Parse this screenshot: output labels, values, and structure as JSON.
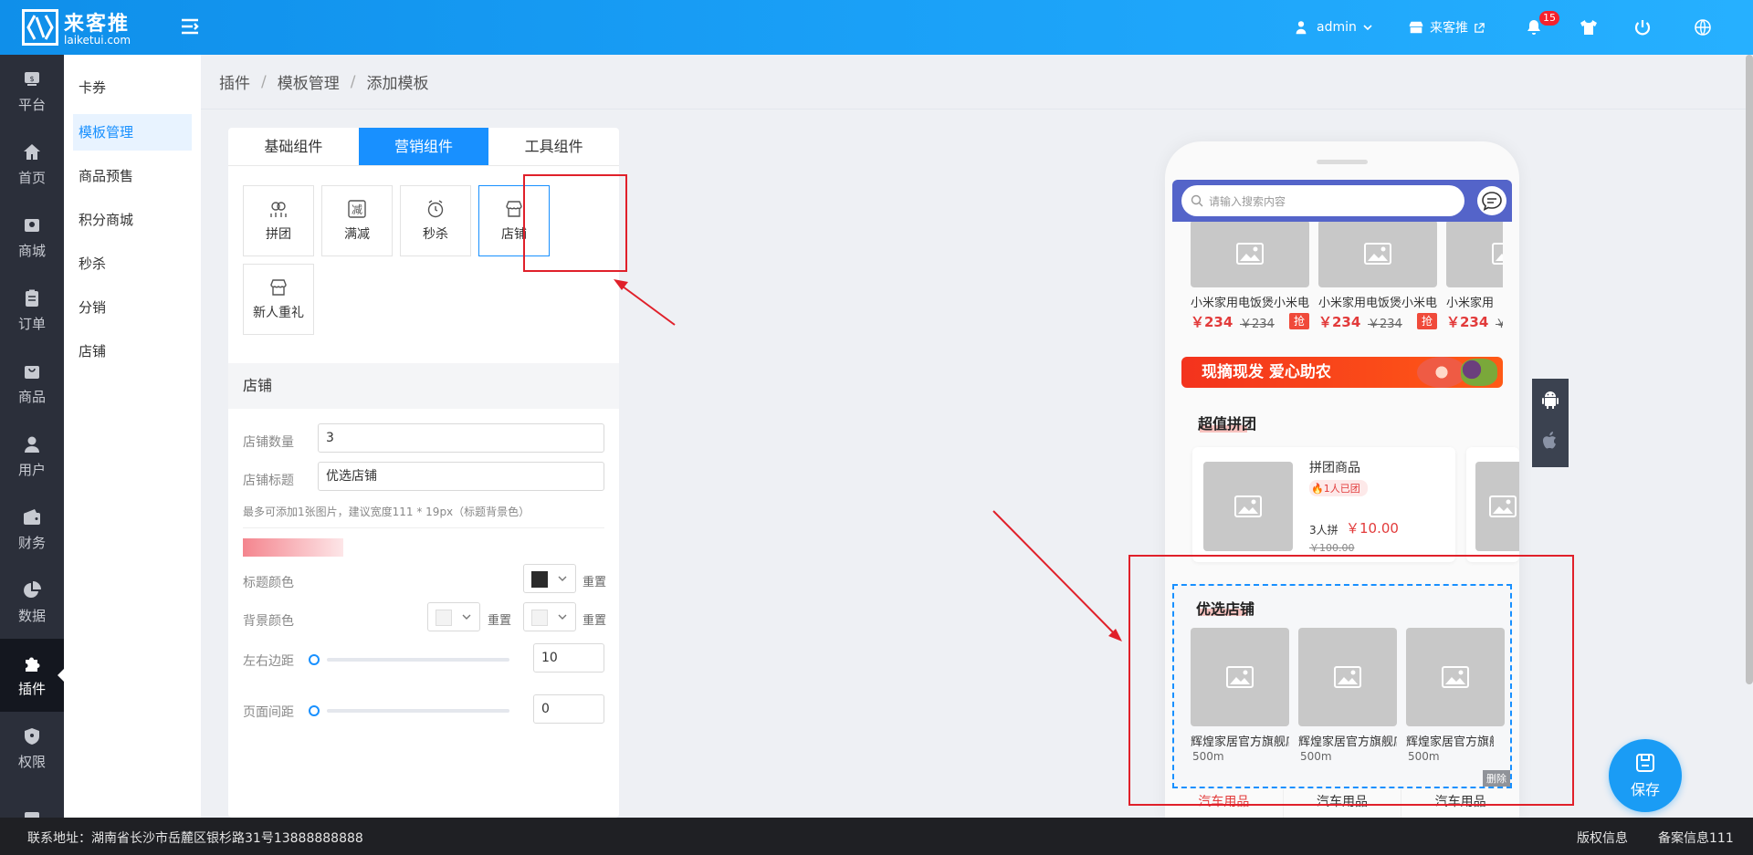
{
  "header": {
    "logo_cn": "来客推",
    "logo_en": "laiketui.com",
    "admin_label": "admin",
    "store_label": "来客推",
    "notification_count": "15"
  },
  "sidebar_main": {
    "items": [
      {
        "label": "平台",
        "icon": "store-sign-icon"
      },
      {
        "label": "首页",
        "icon": "home-icon"
      },
      {
        "label": "商城",
        "icon": "shop-icon"
      },
      {
        "label": "订单",
        "icon": "clipboard-icon"
      },
      {
        "label": "商品",
        "icon": "bag-icon"
      },
      {
        "label": "用户",
        "icon": "user-icon"
      },
      {
        "label": "财务",
        "icon": "wallet-icon"
      },
      {
        "label": "数据",
        "icon": "pie-chart-icon"
      },
      {
        "label": "插件",
        "icon": "puzzle-icon",
        "active": true
      },
      {
        "label": "权限",
        "icon": "shield-icon"
      }
    ]
  },
  "sidebar_sub": {
    "items": [
      "卡券",
      "模板管理",
      "商品预售",
      "积分商城",
      "秒杀",
      "分销",
      "店铺"
    ],
    "active_index": 1
  },
  "breadcrumb": [
    "插件",
    "模板管理",
    "添加模板"
  ],
  "editor": {
    "tabs": [
      "基础组件",
      "营销组件",
      "工具组件"
    ],
    "active_tab": 1,
    "components": [
      {
        "label": "拼团",
        "icon": "group-icon"
      },
      {
        "label": "满减",
        "icon": "discount-icon"
      },
      {
        "label": "秒杀",
        "icon": "alarm-icon"
      },
      {
        "label": "店铺",
        "icon": "store-icon"
      },
      {
        "label": "新人重礼",
        "icon": "gift-icon"
      }
    ],
    "section_title": "店铺",
    "store_count_label": "店铺数量",
    "store_count_value": "3",
    "store_title_label": "店铺标题",
    "store_title_value": "优选店铺",
    "hint": "最多可添加1张图片，建议宽度111 * 19px（标题背景色）",
    "title_color_label": "标题颜色",
    "title_color": "#333333",
    "bg_color_label": "背景颜色",
    "reset_label": "重置",
    "padding_label": "左右边距",
    "padding_value": "10",
    "page_gap_label": "页面间距",
    "page_gap_value": "0",
    "padding_slider_fraction": 0,
    "page_gap_slider_fraction": 0
  },
  "preview": {
    "search_placeholder": "请输入搜索内容",
    "products": [
      {
        "name": "小米家用电饭煲小米电饭煲",
        "price": "￥234",
        "old": "￥234",
        "tag": "抢"
      },
      {
        "name": "小米家用电饭煲小米电饭煲",
        "price": "￥234",
        "old": "￥234",
        "tag": "抢"
      },
      {
        "name": "小米家用",
        "price": "￥234",
        "old": "￥"
      }
    ],
    "banner_text": "现摘现发 爱心助农",
    "group_title": "超值拼团",
    "group_product": {
      "name": "拼团商品",
      "joined": "🔥1人已团",
      "people": "3人拼",
      "price": "￥10.00",
      "old": "￥100.00"
    },
    "store_title": "优选店铺",
    "stores": [
      {
        "name": "辉煌家居官方旗舰店",
        "dist": "500m"
      },
      {
        "name": "辉煌家居官方旗舰店",
        "dist": "500m"
      },
      {
        "name": "辉煌家居官方旗舰店",
        "dist": "500m"
      }
    ],
    "delete_label": "删除",
    "bottom_tabs": [
      "汽车用品",
      "汽车用品",
      "汽车用品"
    ]
  },
  "save_label": "保存",
  "footer": {
    "address": "联系地址：湖南省长沙市岳麓区银杉路31号13888888888",
    "copyright": "版权信息",
    "record": "备案信息111"
  },
  "colors": {
    "accent": "#1890ff",
    "header": "#1aa0f7",
    "sidebar": "#2b2f3a",
    "price": "#e23b3b",
    "annotation": "#e0202a"
  }
}
